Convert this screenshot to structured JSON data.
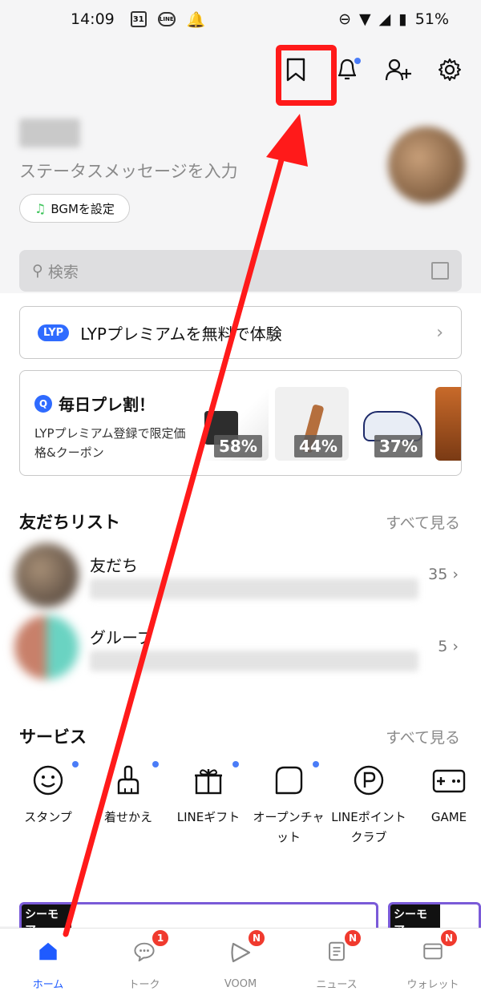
{
  "status_bar": {
    "time": "14:09",
    "calendar": "31",
    "line": "LINE",
    "battery": "51%"
  },
  "profile": {
    "status_message": "ステータスメッセージを入力",
    "bgm_label": "BGMを設定"
  },
  "search": {
    "placeholder": "検索"
  },
  "lyp_banner": {
    "logo": "LYP",
    "text": "LYPプレミアムを無料で体験"
  },
  "deal": {
    "title": "毎日プレ割！",
    "subtitle": "LYPプレミアム登録で限定価格&クーポン",
    "items": [
      {
        "discount": "58%"
      },
      {
        "discount": "44%"
      },
      {
        "discount": "37%"
      }
    ]
  },
  "friends_section": {
    "title": "友だちリスト",
    "see_all": "すべて見る",
    "rows": [
      {
        "label": "友だち",
        "count": "35"
      },
      {
        "label": "グループ",
        "count": "5"
      }
    ]
  },
  "services_section": {
    "title": "サービス",
    "see_all": "すべて見る",
    "items": [
      {
        "label": "スタンプ",
        "icon": "smiley-icon"
      },
      {
        "label": "着せかえ",
        "icon": "brush-icon"
      },
      {
        "label": "LINEギフト",
        "icon": "gift-icon"
      },
      {
        "label": "オープンチャット",
        "icon": "open-chat-icon"
      },
      {
        "label": "LINEポイントクラブ",
        "icon": "points-icon"
      },
      {
        "label": "GAME",
        "icon": "game-icon"
      }
    ]
  },
  "bottom_nav": [
    {
      "label": "ホーム",
      "icon": "home-icon",
      "badge": ""
    },
    {
      "label": "トーク",
      "icon": "chat-icon",
      "badge": "1"
    },
    {
      "label": "VOOM",
      "icon": "voom-icon",
      "badge": "N"
    },
    {
      "label": "ニュース",
      "icon": "news-icon",
      "badge": "N"
    },
    {
      "label": "ウォレット",
      "icon": "wallet-icon",
      "badge": "N"
    }
  ],
  "colors": {
    "accent": "#1f5bff",
    "badge": "#f03a2e",
    "annotation": "#ff1a1a"
  }
}
